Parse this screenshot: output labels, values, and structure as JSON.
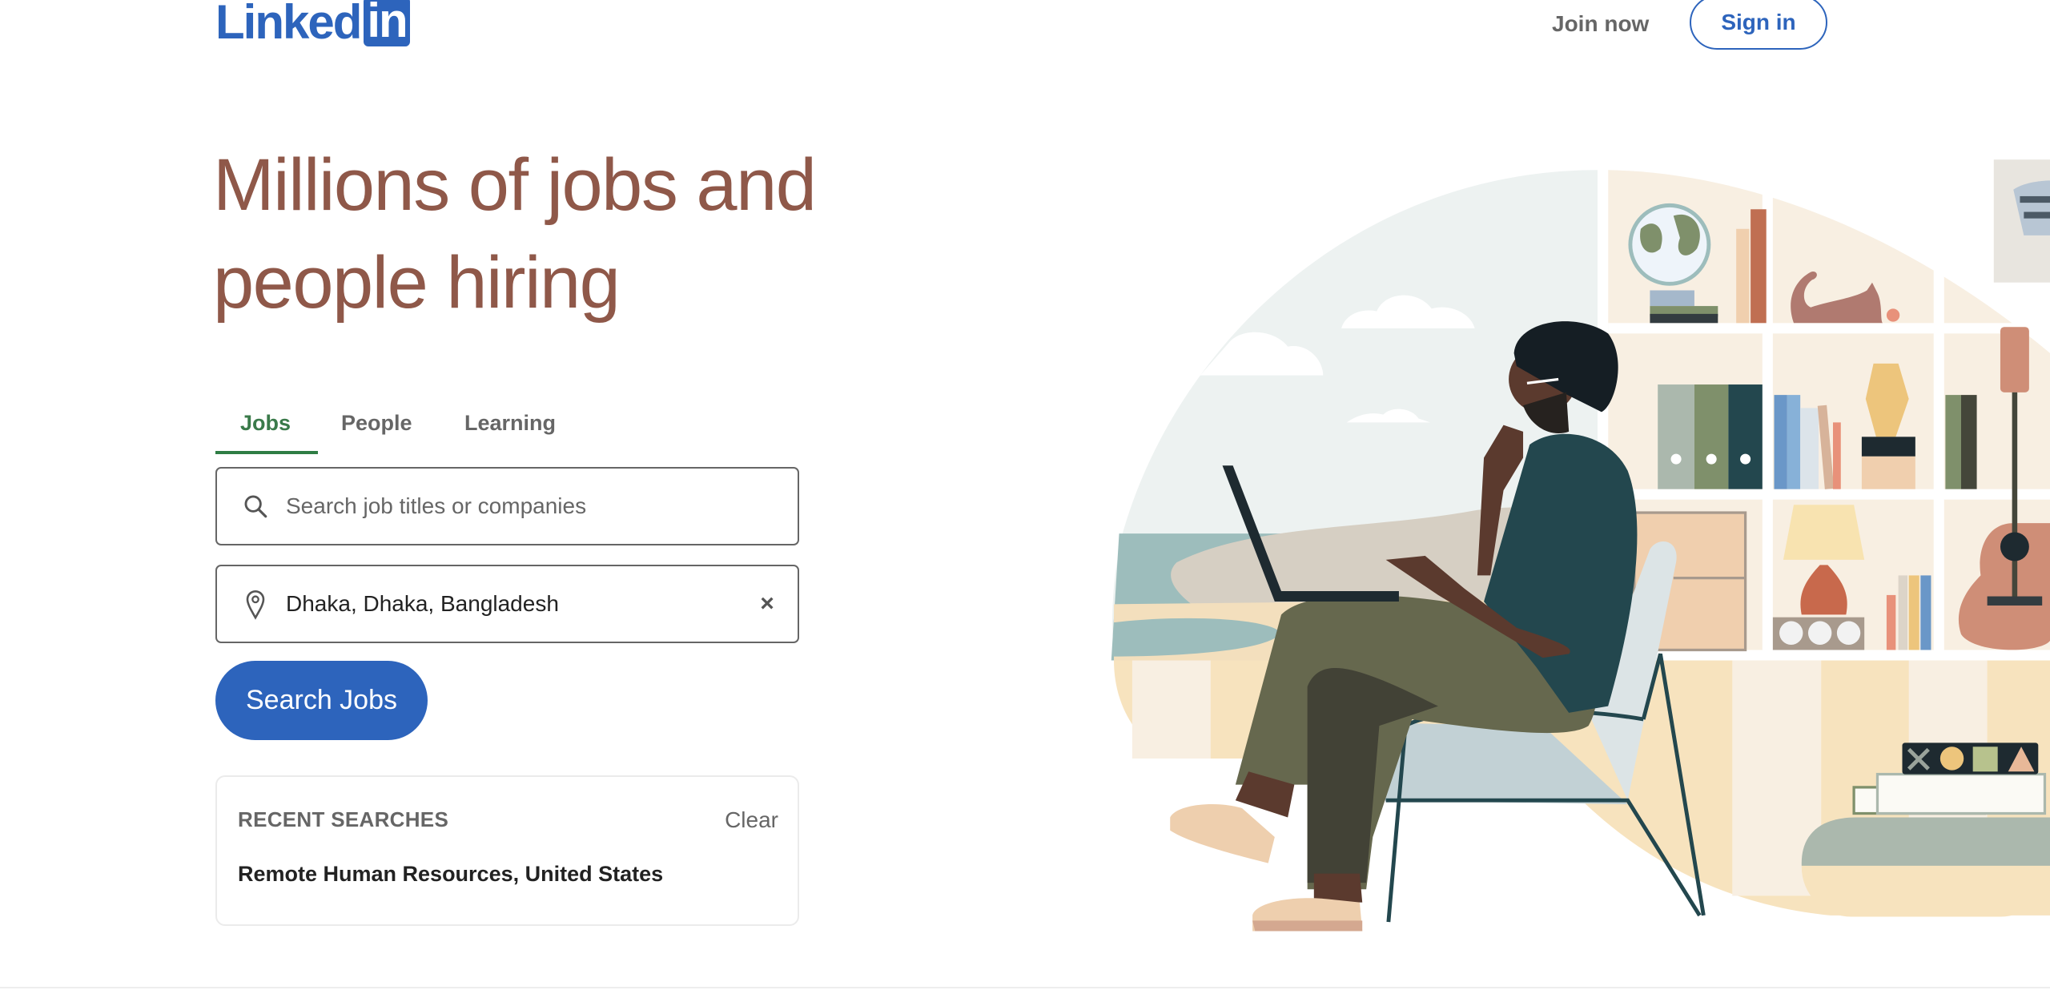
{
  "header": {
    "logo_text": "Linked",
    "logo_badge": "in",
    "join_label": "Join now",
    "signin_label": "Sign in"
  },
  "hero": {
    "title_line1": "Millions of jobs and",
    "title_line2": "people hiring"
  },
  "tabs": [
    {
      "label": "Jobs",
      "active": true
    },
    {
      "label": "People",
      "active": false
    },
    {
      "label": "Learning",
      "active": false
    }
  ],
  "search": {
    "job_placeholder": "Search job titles or companies",
    "job_value": "",
    "location_value": "Dhaka, Dhaka, Bangladesh",
    "button_label": "Search Jobs",
    "icons": {
      "job": "search-icon",
      "location": "location-pin-icon",
      "clear": "close-icon"
    }
  },
  "recent": {
    "title": "RECENT SEARCHES",
    "clear_label": "Clear",
    "items": [
      "Remote Human Resources, United States"
    ]
  },
  "colors": {
    "brand": "#2d64bc",
    "headline": "#8f5849",
    "active_tab": "#3a7a4a"
  }
}
